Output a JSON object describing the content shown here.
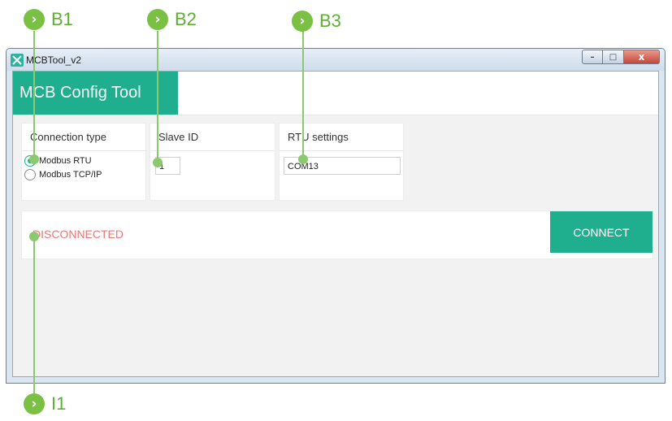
{
  "callouts": {
    "b1": "B1",
    "b2": "B2",
    "b3": "B3",
    "i1": "I1",
    "badge_glyph": "›"
  },
  "window": {
    "title": "MCBTool_v2",
    "controls": {
      "minimize": "–",
      "maximize": "□",
      "close": "x"
    }
  },
  "app": {
    "title": "MCB Config Tool",
    "accent_color": "#1fae8e"
  },
  "connection_panel": {
    "header": "Connection type",
    "options": [
      {
        "label": "Modbus RTU",
        "selected": true
      },
      {
        "label": "Modbus TCP/IP",
        "selected": false
      }
    ]
  },
  "slave_panel": {
    "header": "Slave ID",
    "value": "1"
  },
  "rtu_panel": {
    "header": "RTU settings",
    "port": "COM13"
  },
  "status": {
    "text": "DISCONNECTED",
    "color": "#e57a78"
  },
  "connect_button": {
    "label": "CONNECT"
  }
}
